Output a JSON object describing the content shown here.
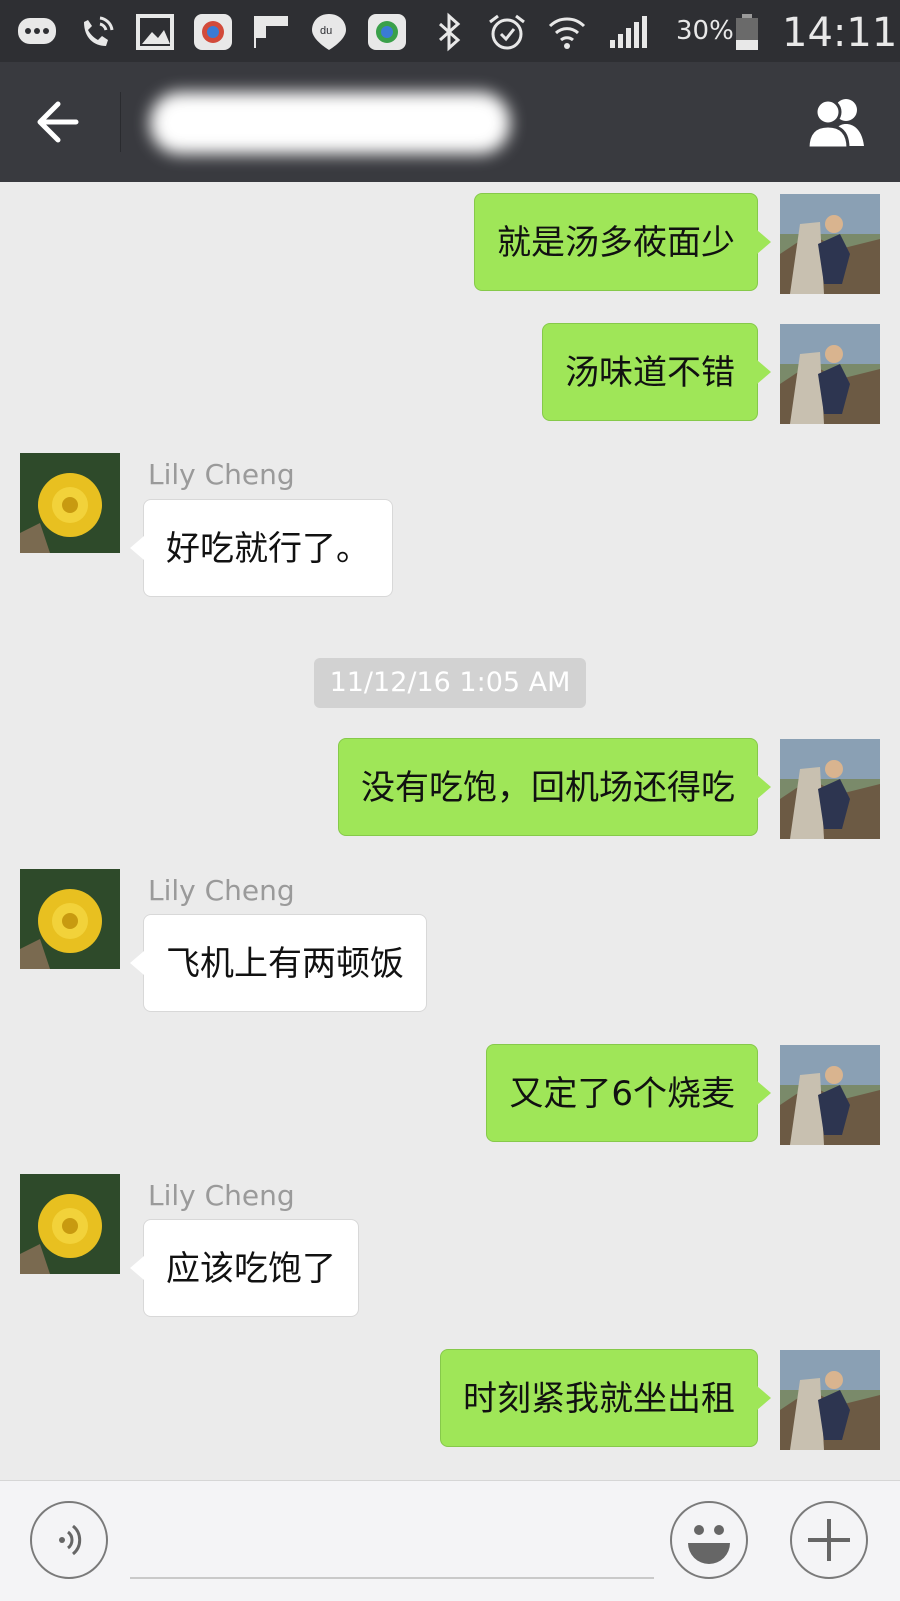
{
  "status_bar": {
    "icons": [
      "message-bubble-icon",
      "wifi-calling-icon",
      "image-icon",
      "app-icon",
      "flipboard-icon",
      "baidu-maps-icon",
      "app-icon",
      "bluetooth-icon",
      "alarm-icon",
      "wifi-icon",
      "signal-icon",
      "battery-icon"
    ],
    "battery_text": "30%",
    "time": "14:11"
  },
  "header": {
    "title": "",
    "back_icon": "arrow-left-icon",
    "members_icon": "people-icon"
  },
  "messages": [
    {
      "from": "me",
      "text": "就是汤多莜面少"
    },
    {
      "from": "me",
      "text": "汤味道不错"
    },
    {
      "from": "other",
      "sender": "Lily Cheng",
      "text": "好吃就行了。"
    },
    {
      "timestamp": "11/12/16 1:05 AM"
    },
    {
      "from": "me",
      "text": "没有吃饱，回机场还得吃"
    },
    {
      "from": "other",
      "sender": "Lily Cheng",
      "text": "飞机上有两顿饭"
    },
    {
      "from": "me",
      "text": "又定了6个烧麦"
    },
    {
      "from": "other",
      "sender": "Lily Cheng",
      "text": "应该吃饱了"
    },
    {
      "from": "me",
      "text": "时刻紧我就坐出租"
    }
  ],
  "input_bar": {
    "voice_icon": "voice-icon",
    "emoji_icon": "emoji-icon",
    "plus_icon": "plus-icon",
    "placeholder": ""
  },
  "colors": {
    "my_bubble": "#9fe658",
    "other_bubble": "#ffffff",
    "chat_background": "#ebebeb",
    "header": "#393a3f"
  }
}
